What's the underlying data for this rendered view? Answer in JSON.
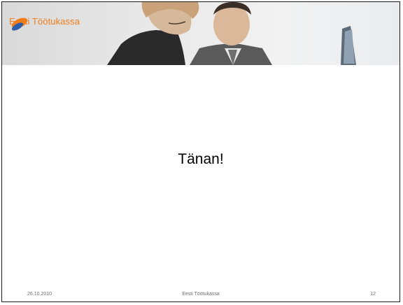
{
  "header": {
    "logo_text": "Eesti Töötukassa",
    "logo_icon": "tootukassa-logo-icon"
  },
  "main": {
    "text": "Tänan!"
  },
  "footer": {
    "date": "26.10.2010",
    "center": "Eesti Töötukassa",
    "page": "12"
  },
  "colors": {
    "brand_orange": "#f07d1a",
    "brand_blue": "#2b5da8"
  }
}
